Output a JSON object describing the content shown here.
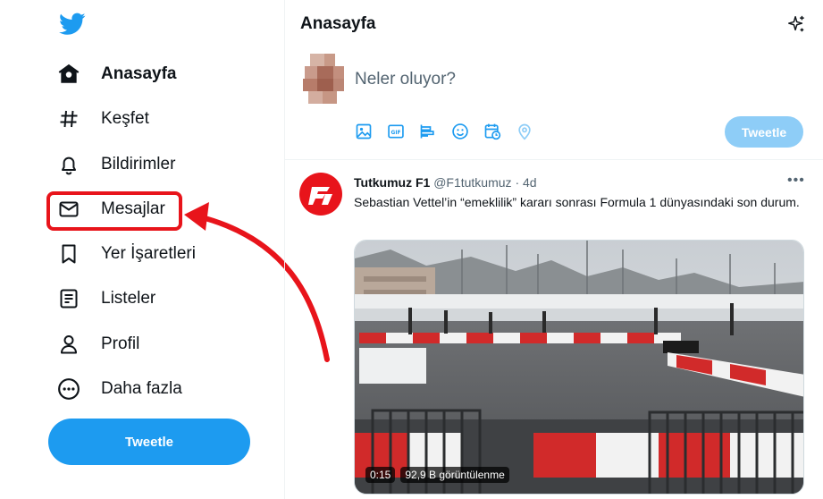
{
  "sidebar": {
    "logo": "twitter-bird-icon",
    "items": [
      {
        "label": "Anasayfa",
        "icon": "home-icon",
        "active": true
      },
      {
        "label": "Keşfet",
        "icon": "hashtag-icon"
      },
      {
        "label": "Bildirimler",
        "icon": "bell-icon"
      },
      {
        "label": "Mesajlar",
        "icon": "envelope-icon"
      },
      {
        "label": "Yer İşaretleri",
        "icon": "bookmark-icon"
      },
      {
        "label": "Listeler",
        "icon": "list-icon"
      },
      {
        "label": "Profil",
        "icon": "person-icon"
      },
      {
        "label": "Daha fazla",
        "icon": "more-circle-icon"
      }
    ],
    "tweet_button": "Tweetle"
  },
  "header": {
    "title": "Anasayfa",
    "icon": "sparkle-icon"
  },
  "composer": {
    "placeholder": "Neler oluyor?",
    "tools": [
      "image-icon",
      "gif-icon",
      "poll-icon",
      "emoji-icon",
      "schedule-icon",
      "location-icon"
    ],
    "tweet_button": "Tweetle"
  },
  "tweet": {
    "name": "Tutkumuz F1",
    "handle": "@F1tutkumuz",
    "separator": "·",
    "time": "4d",
    "text": "Sebastian Vettel’in “emeklilik” kararı sonrası Formula 1 dünyasındaki son durum.",
    "media": {
      "duration": "0:15",
      "views": "92,9 B görüntülenme"
    }
  },
  "annotation": {
    "color": "#e8141b",
    "target": "Mesajlar"
  },
  "colors": {
    "accent": "#1d9bf0",
    "accent_disabled": "#8ecdf7",
    "text": "#0f1419",
    "muted": "#536471"
  }
}
